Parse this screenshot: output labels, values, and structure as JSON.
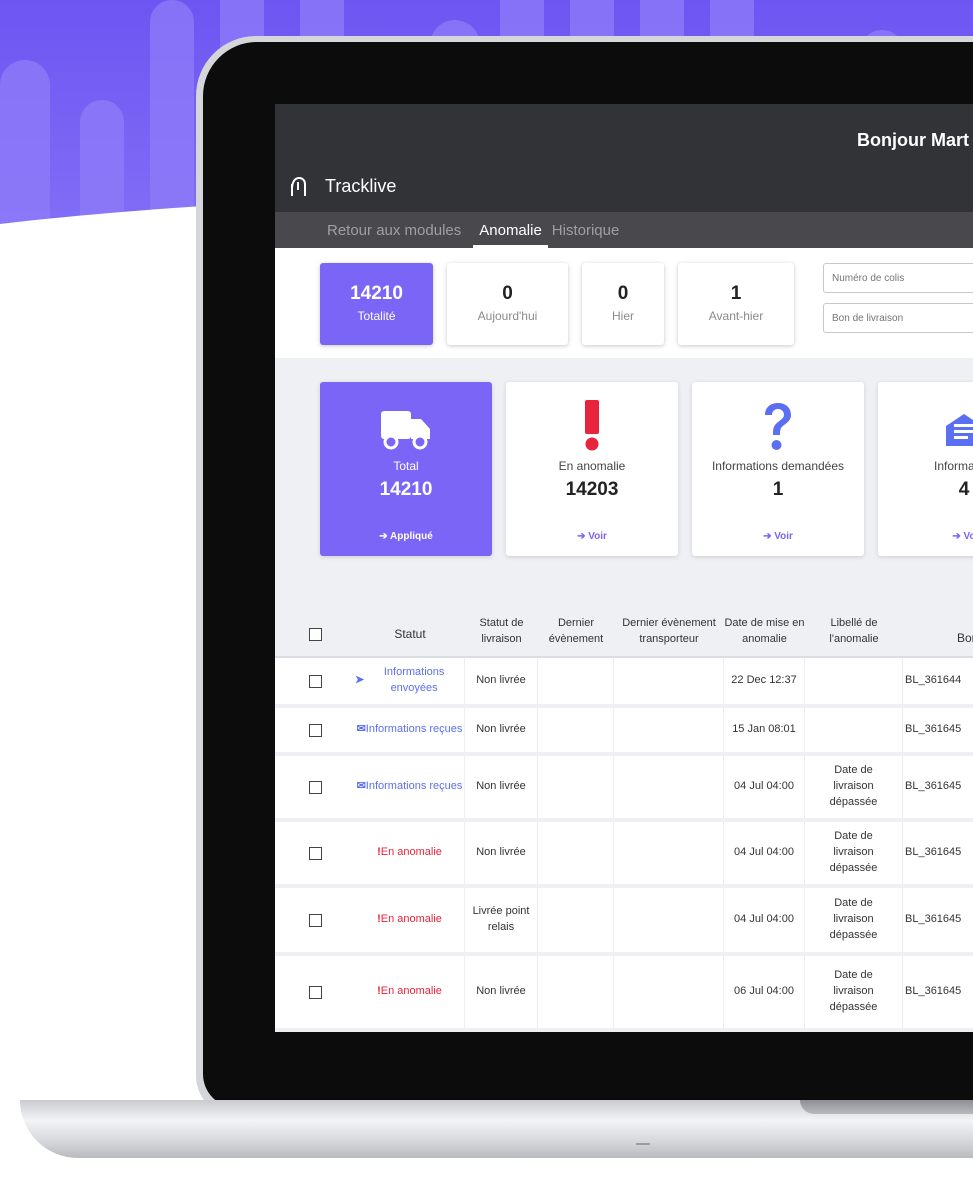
{
  "app": {
    "greeting": "Bonjour Mart",
    "brand": "Tracklive"
  },
  "nav": {
    "items": [
      "Retour aux modules",
      "Anomalie",
      "Historique"
    ],
    "active_index": 1
  },
  "counters": [
    {
      "value": "14210",
      "label": "Totalité"
    },
    {
      "value": "0",
      "label": "Aujourd'hui"
    },
    {
      "value": "0",
      "label": "Hier"
    },
    {
      "value": "1",
      "label": "Avant-hier"
    }
  ],
  "filters": {
    "parcel_placeholder": "Numéro de colis",
    "delivery_note_placeholder": "Bon de livraison"
  },
  "cards": [
    {
      "icon": "truck-icon",
      "label": "Total",
      "value": "14210",
      "action": "➔ Appliqué"
    },
    {
      "icon": "exclamation-icon",
      "label": "En anomalie",
      "value": "14203",
      "action": "➔ Voir"
    },
    {
      "icon": "question-icon",
      "label": "Informations demandées",
      "value": "1",
      "action": "➔ Voir"
    },
    {
      "icon": "mail-icon",
      "label": "Information",
      "value": "4",
      "action": "➔ Vo"
    }
  ],
  "table": {
    "headers": {
      "statut": "Statut",
      "statut_livraison": "Statut de livraison",
      "dernier_evenement": "Dernier évènement",
      "dernier_evenement_transporteur": "Dernier évènement transporteur",
      "date_mise_anomalie": "Date de mise en anomalie",
      "libelle_anomalie": "Libellé de l'anomalie",
      "bon": "Bon c"
    },
    "rows": [
      {
        "status": "Informations envoyées",
        "status_type": "sent",
        "livraison": "Non livrée",
        "date": "22 Dec 12:37",
        "libelle": "",
        "bon": "BL_361644"
      },
      {
        "status": "Informations reçues",
        "status_type": "received",
        "livraison": "Non livrée",
        "date": "15 Jan 08:01",
        "libelle": "",
        "bon": "BL_361645"
      },
      {
        "status": "Informations reçues",
        "status_type": "received",
        "livraison": "Non livrée",
        "date": "04 Jul 04:00",
        "libelle": "Date de livraison dépassée",
        "bon": "BL_361645"
      },
      {
        "status": "En anomalie",
        "status_type": "anomaly",
        "livraison": "Non livrée",
        "date": "04 Jul 04:00",
        "libelle": "Date de livraison dépassée",
        "bon": "BL_361645"
      },
      {
        "status": "En anomalie",
        "status_type": "anomaly",
        "livraison": "Livrée point relais",
        "date": "04 Jul 04:00",
        "libelle": "Date de livraison dépassée",
        "bon": "BL_361645"
      },
      {
        "status": "En anomalie",
        "status_type": "anomaly",
        "livraison": "Non livrée",
        "date": "06 Jul 04:00",
        "libelle": "Date de livraison dépassée",
        "bon": "BL_361645"
      }
    ]
  },
  "colors": {
    "accent": "#7b65f6",
    "topbar": "#323336",
    "nav": "#49494d",
    "anomaly": "#e8243c",
    "info": "#5b6ff2"
  }
}
